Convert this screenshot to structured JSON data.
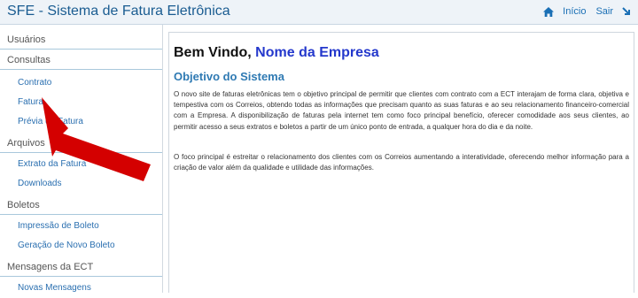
{
  "header": {
    "title": "SFE - Sistema de Fatura Eletrônica",
    "nav": {
      "inicio": "Início",
      "sair": "Sair"
    }
  },
  "sidebar": {
    "usuarios": "Usuários",
    "consultas": "Consultas",
    "consultas_items": [
      "Contrato",
      "Fatura",
      "Prévia de Fatura"
    ],
    "arquivos": "Arquivos",
    "arquivos_items": [
      "Extrato da Fatura",
      "Downloads"
    ],
    "boletos": "Boletos",
    "boletos_items": [
      "Impressão de Boleto",
      "Geração de Novo Boleto"
    ],
    "mensagens": "Mensagens da ECT",
    "mensagens_items": [
      "Novas Mensagens"
    ]
  },
  "main": {
    "welcome": "Bem Vindo,",
    "company": "Nome da Empresa",
    "section_title": "Objetivo do Sistema",
    "paragraph1": "O novo site de faturas eletrônicas tem o objetivo principal de permitir que clientes com contrato com a ECT interajam de forma clara, objetiva e tempestiva com os Correios, obtendo todas as informações que precisam quanto as suas faturas e ao seu relacionamento financeiro-comercial com a Empresa. A disponibilização de faturas pela internet tem como foco principal benefício, oferecer comodidade aos seus clientes, ao permitir acesso a seus extratos e boletos a partir de um único ponto de entrada, a qualquer hora do dia e da noite.",
    "paragraph2": "O foco principal é estreitar o relacionamento dos clientes com os Correios aumentando a interatividade, oferecendo melhor informação para a criação de valor além da qualidade e utilidade das informações."
  },
  "colors": {
    "accent": "#1a6fb5",
    "company": "#2438cc",
    "arrow": "#d40000"
  },
  "icons": {
    "home": "home-icon",
    "exit": "exit-arrow-icon",
    "annotation": "red-arrow"
  }
}
